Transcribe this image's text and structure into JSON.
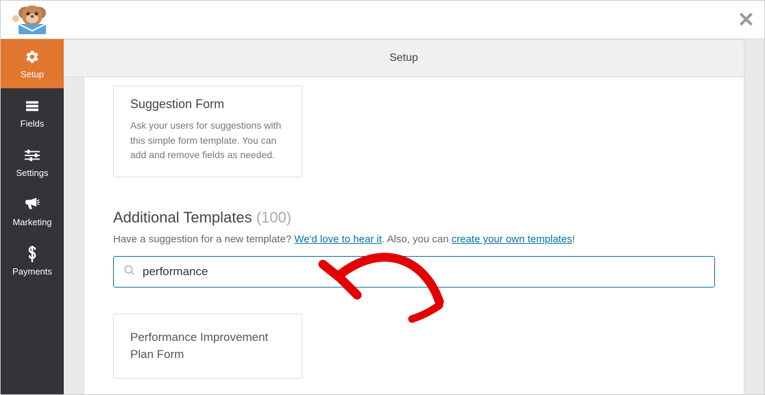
{
  "header": {
    "close_label": "✕"
  },
  "sidebar": {
    "items": [
      {
        "label": "Setup",
        "icon": "gear",
        "active": true
      },
      {
        "label": "Fields",
        "icon": "list",
        "active": false
      },
      {
        "label": "Settings",
        "icon": "sliders",
        "active": false
      },
      {
        "label": "Marketing",
        "icon": "bullhorn",
        "active": false
      },
      {
        "label": "Payments",
        "icon": "dollar",
        "active": false
      }
    ]
  },
  "tabs": {
    "setup": "Setup"
  },
  "cards": {
    "suggestion": {
      "title": "Suggestion Form",
      "desc": "Ask your users for suggestions with this simple form template. You can add and remove fields as needed."
    },
    "result": {
      "title": "Performance Improvement Plan Form"
    }
  },
  "additional": {
    "heading": "Additional Templates",
    "count": "(100)",
    "line_prefix": "Have a suggestion for a new template? ",
    "link1": "We'd love to hear it",
    "line_mid": ". Also, you can ",
    "link2": "create your own templates",
    "line_suffix": "!"
  },
  "search": {
    "value": "performance"
  }
}
